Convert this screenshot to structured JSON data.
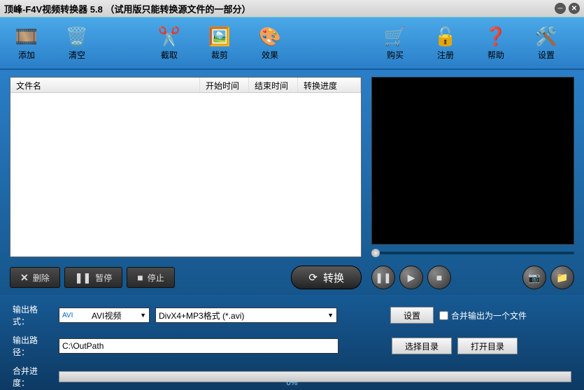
{
  "title": "顶峰-F4V视频转换器 5.8 （试用版只能转换源文件的一部分）",
  "toolbar": {
    "add": "添加",
    "clear": "清空",
    "cut": "截取",
    "crop": "裁剪",
    "effect": "效果",
    "buy": "购买",
    "register": "注册",
    "help": "帮助",
    "settings": "设置"
  },
  "filelist": {
    "col_filename": "文件名",
    "col_start": "开始时间",
    "col_end": "结束时间",
    "col_progress": "转换进度"
  },
  "buttons": {
    "delete": "删除",
    "pause": "暂停",
    "stop": "停止",
    "convert": "转换",
    "setfmt": "设置",
    "browse": "选择目录",
    "open": "打开目录"
  },
  "output": {
    "format_label": "输出格式：",
    "format_sel1": "AVI视频",
    "format_sel2": "DivX4+MP3格式 (*.avi)",
    "merge_label": "合并输出为一个文件",
    "path_label": "输出路径：",
    "path_value": "C:\\OutPath"
  },
  "progress": {
    "label": "合并进度：",
    "percent": "0%"
  }
}
